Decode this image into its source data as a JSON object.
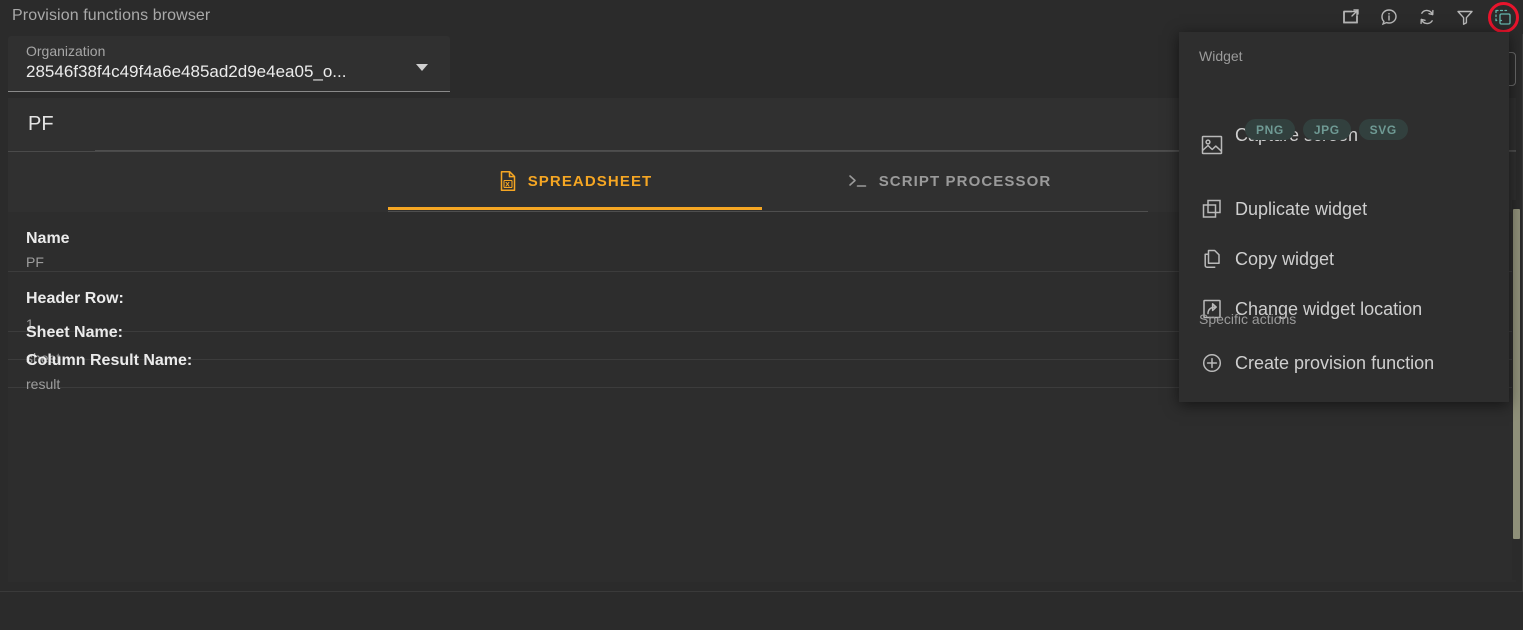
{
  "window": {
    "title": "Provision functions browser"
  },
  "toolbar": {
    "icons": [
      {
        "name": "open-external-icon",
        "title": "Open in new window"
      },
      {
        "name": "info-icon",
        "title": "Information"
      },
      {
        "name": "refresh-icon",
        "title": "Refresh"
      },
      {
        "name": "filter-icon",
        "title": "Filter"
      },
      {
        "name": "widget-menu-icon",
        "title": "Widget actions"
      }
    ],
    "highlight_color": "#e8142c",
    "active_icon_color": "#64b5ac"
  },
  "organization": {
    "label": "Organization",
    "value": "28546f38f4c49f4a6e485ad2d9e4ea05_o...",
    "caret": "chevron-down-icon"
  },
  "header": {
    "title": "PF"
  },
  "tabs": {
    "accent_color": "#f5a623",
    "items": [
      {
        "label": "SPREADSHEET",
        "icon": "spreadsheet-file-icon",
        "active": true
      },
      {
        "label": "SCRIPT PROCESSOR",
        "icon": "terminal-prompt-icon",
        "active": false
      }
    ]
  },
  "details": [
    {
      "label": "Name",
      "value": "PF"
    },
    {
      "label": "Header Row:",
      "value": "1"
    },
    {
      "label": "Sheet Name:",
      "value": "sheet"
    },
    {
      "label": "Column Result Name:",
      "value": "result"
    }
  ],
  "menu": {
    "sections": [
      {
        "title": "Widget",
        "items": [
          {
            "label": "Capture screen",
            "icon": "image-icon",
            "chips": [
              "PNG",
              "JPG",
              "SVG"
            ]
          },
          {
            "label": "Duplicate widget",
            "icon": "duplicate-icon"
          },
          {
            "label": "Copy widget",
            "icon": "copy-icon"
          },
          {
            "label": "Change widget location",
            "icon": "move-location-icon"
          }
        ]
      },
      {
        "title": "Specific actions",
        "items": [
          {
            "label": "Create provision function",
            "icon": "plus-circle-icon"
          }
        ]
      }
    ]
  },
  "scrollbar": {
    "thumb_color": "#8e8f79"
  }
}
